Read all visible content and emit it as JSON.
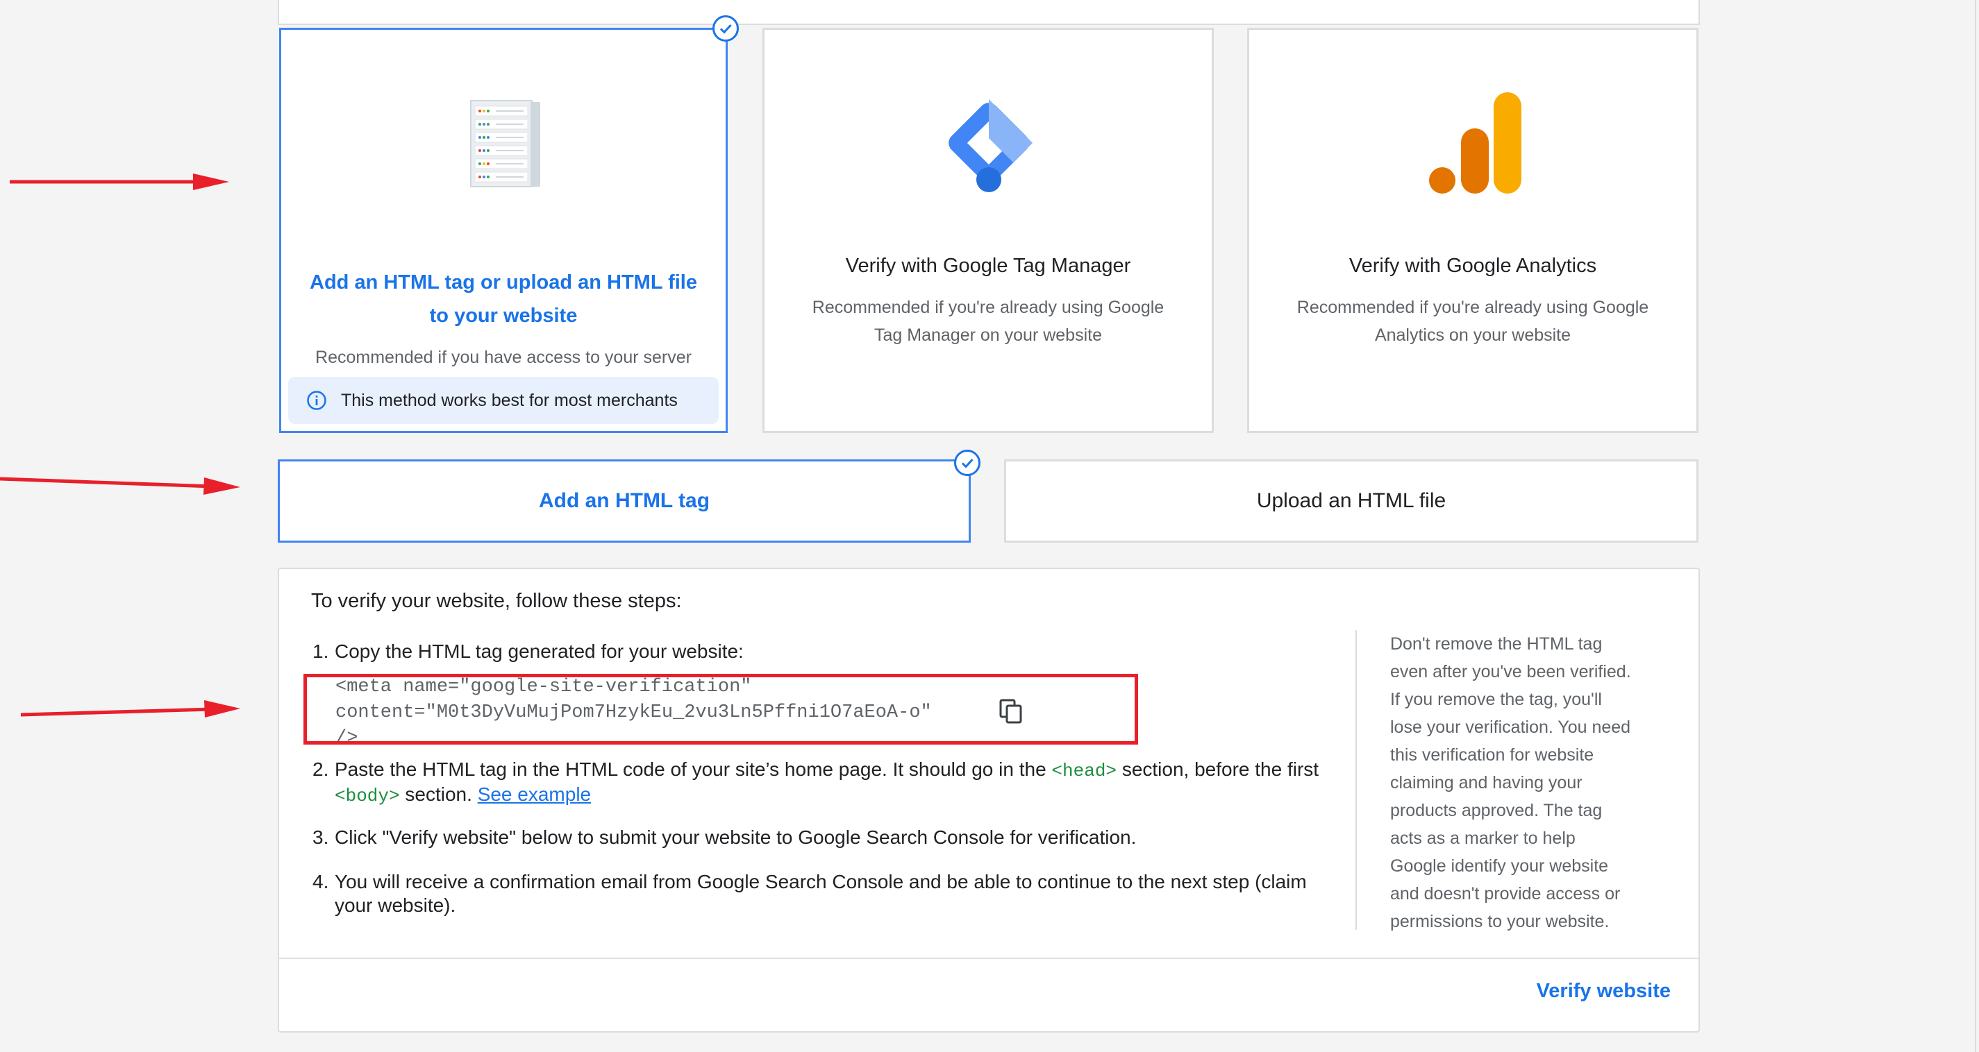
{
  "methods": [
    {
      "title": "Add an HTML tag or upload an HTML file to your website",
      "title_line1": "Add an HTML tag or upload an HTML file",
      "title_line2": "to your website",
      "subtitle": "Recommended if you have access to your server",
      "info": "This method works best for most merchants",
      "icon": "server-icon",
      "selected": true
    },
    {
      "title": "Verify with Google Tag Manager",
      "subtitle_line1": "Recommended if you're already using Google",
      "subtitle_line2": "Tag Manager on your website",
      "icon": "google-tag-manager-icon",
      "selected": false
    },
    {
      "title": "Verify with Google Analytics",
      "subtitle_line1": "Recommended if you're already using Google",
      "subtitle_line2": "Analytics on your website",
      "icon": "google-analytics-icon",
      "selected": false
    }
  ],
  "tabs": [
    {
      "label": "Add an HTML tag",
      "active": true
    },
    {
      "label": "Upload an HTML file",
      "active": false
    }
  ],
  "steps": {
    "heading": "To verify your website, follow these steps:",
    "items": [
      {
        "num": "1.",
        "text": "Copy the HTML tag generated for your website:"
      },
      {
        "num": "2.",
        "text_a": "Paste the HTML tag in the HTML code of your site’s home page. It should go in the",
        "tag_head": "<head>",
        "text_b": "section, before the first",
        "tag_body": "<body>",
        "text_c": "section.",
        "link": "See example"
      },
      {
        "num": "3.",
        "text": "Click \"Verify website\" below to submit your website to Google Search Console for verification."
      },
      {
        "num": "4.",
        "text_line1": "You will receive a confirmation email from Google Search Console and be able to continue to the next step (claim",
        "text_line2": "your website)."
      }
    ],
    "code_line1": "<meta name=\"google-site-verification\"",
    "code_line2": "content=\"M0t3DyVuMujPom7HzykEu_2vu3Ln5Pffni1O7aEoA-o\" />",
    "side_note_lines": [
      "Don't remove the HTML tag",
      "even after you've been verified.",
      "If you remove the tag, you'll",
      "lose your verification. You need",
      "this verification for website",
      "claiming and having your",
      "products approved. The tag",
      "acts as a marker to help",
      "Google identify your website",
      "and doesn't provide access or",
      "permissions to your website."
    ],
    "verify_label": "Verify website"
  },
  "colors": {
    "accent": "#1a73e8",
    "annotation": "#e8202a",
    "analytics_orange": "#e8710a",
    "analytics_yellow": "#f9ab00"
  }
}
